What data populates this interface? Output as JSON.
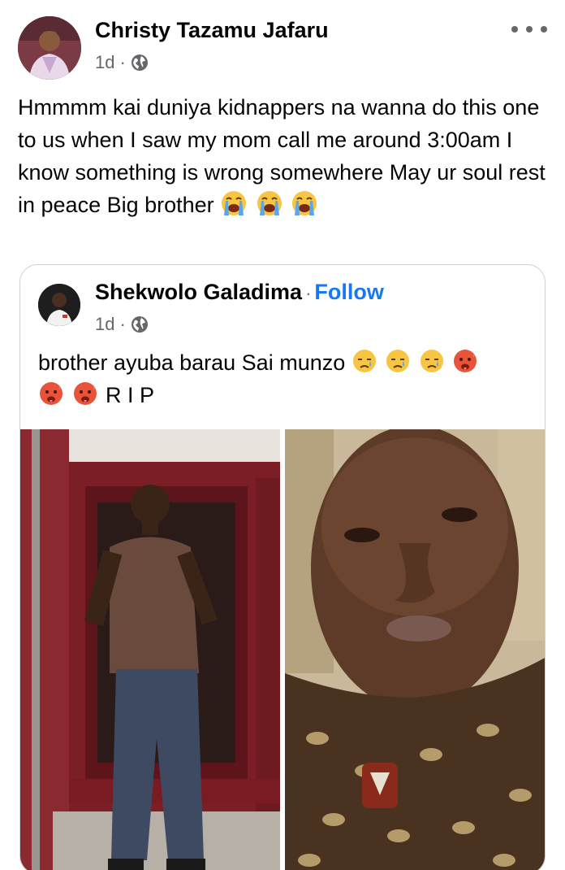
{
  "post": {
    "author": "Christy Tazamu Jafaru",
    "time": "1d",
    "separator": "·",
    "privacy_icon": "globe-icon",
    "text": "Hmmmm kai duniya kidnappers na wanna do this one to us when I saw my mom call me around 3:00am I know something is wrong somewhere May ur soul rest in peace Big brother",
    "text_emojis": [
      "loudly-crying-face",
      "loudly-crying-face",
      "loudly-crying-face"
    ]
  },
  "shared": {
    "author": "Shekwolo Galadima",
    "separator": "·",
    "follow_label": "Follow",
    "time": "1d",
    "privacy_icon": "globe-icon",
    "text": "brother ayuba barau Sai munzo",
    "emojis_line1": [
      "sad-tear-face",
      "sad-tear-face",
      "sad-tear-face",
      "hot-face"
    ],
    "emojis_line2": [
      "hot-face",
      "hot-face"
    ],
    "text_end": "R I P",
    "photos": [
      "man-standing-by-red-truck",
      "man-selfie-closeup"
    ]
  },
  "colors": {
    "link": "#1877f2",
    "secondary_text": "#65676b",
    "border": "#ced0d4"
  }
}
